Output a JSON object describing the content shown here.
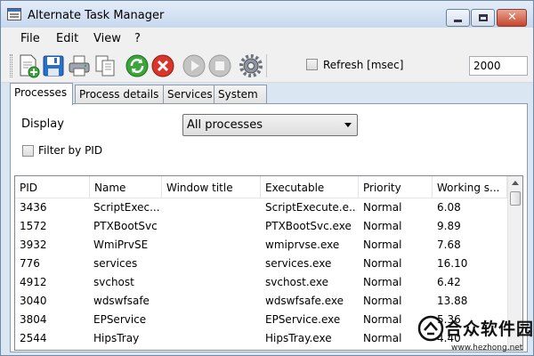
{
  "window": {
    "title": "Alternate Task Manager",
    "minimize_glyph": "minimize-icon",
    "maximize_glyph": "maximize-icon",
    "close_glyph": "✕"
  },
  "menu": [
    "File",
    "Edit",
    "View",
    "?"
  ],
  "toolbar": {
    "buttons": [
      "new-process-icon",
      "save-icon",
      "print-icon",
      "copy-icon",
      "refresh-icon",
      "stop-icon",
      "play-icon",
      "pause-icon",
      "gear-icon"
    ],
    "refresh_label": "Refresh [msec]",
    "refresh_checked": false,
    "refresh_value": "2000"
  },
  "tabs": [
    "Processes",
    "Process details",
    "Services",
    "System"
  ],
  "active_tab": "Processes",
  "processes_tab": {
    "display_label": "Display",
    "display_value": "All processes",
    "filter_label": "Filter by PID",
    "filter_checked": false
  },
  "table": {
    "columns": [
      "PID",
      "Name",
      "Window title",
      "Executable",
      "Priority",
      "Working s..."
    ],
    "rows": [
      [
        "3436",
        "ScriptExec...",
        "",
        "ScriptExecute.e...",
        "Normal",
        "6.08"
      ],
      [
        "1572",
        "PTXBootSvc",
        "",
        "PTXBootSvc.exe",
        "Normal",
        "9.89"
      ],
      [
        "3932",
        "WmiPrvSE",
        "",
        "wmiprvse.exe",
        "Normal",
        "7.68"
      ],
      [
        "776",
        "services",
        "",
        "services.exe",
        "Normal",
        "16.10"
      ],
      [
        "4912",
        "svchost",
        "",
        "svchost.exe",
        "Normal",
        "6.42"
      ],
      [
        "3040",
        "wdswfsafe",
        "",
        "wdswfsafe.exe",
        "Normal",
        "13.88"
      ],
      [
        "3804",
        "EPService",
        "",
        "EPService.exe",
        "Normal",
        "5.36"
      ],
      [
        "2544",
        "HipsTray",
        "",
        "HipsTray.exe",
        "Normal",
        "4.40"
      ]
    ]
  },
  "watermark": {
    "text": "合众软件园",
    "url": "www.hezhong.net"
  },
  "colors": {
    "title_gradient_top": "#e4edf8",
    "title_gradient_bottom": "#c7d8ee",
    "close_button": "#c7442b",
    "refresh_green": "#3aa63a",
    "stop_red": "#d9362b",
    "disabled_gray": "#b0b0b0"
  }
}
